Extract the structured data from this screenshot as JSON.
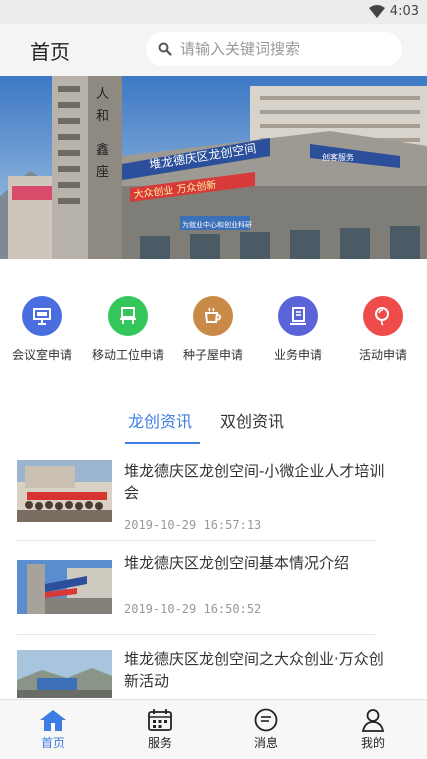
{
  "status_bar": {
    "time": "4:03",
    "wifi_icon": "wifi-icon"
  },
  "header": {
    "title": "首页",
    "search_placeholder": "请输入关键词搜索"
  },
  "banner": {
    "signs": [
      "人",
      "和",
      "鑫",
      "座"
    ],
    "building_sign": "堆龙德庆区龙创空间",
    "slogan": "大众创业 万众创新",
    "small_sign": "为就业中心和创业科研",
    "side_sign": "创客服务"
  },
  "quick_actions": [
    {
      "label": "会议室申请",
      "icon": "presentation-board-icon",
      "color": "#4a6ee0"
    },
    {
      "label": "移动工位申请",
      "icon": "workstation-icon",
      "color": "#34c65a"
    },
    {
      "label": "种子屋申请",
      "icon": "coffee-cup-icon",
      "color": "#c98a47"
    },
    {
      "label": "业务申请",
      "icon": "business-doc-icon",
      "color": "#5b63d8"
    },
    {
      "label": "活动申请",
      "icon": "balloon-icon",
      "color": "#ef4b4b"
    }
  ],
  "tabs": [
    {
      "label": "龙创资讯",
      "active": true
    },
    {
      "label": "双创资讯",
      "active": false
    }
  ],
  "news": [
    {
      "title": "堆龙德庆区龙创空间-小微企业人才培训会",
      "date": "2019-10-29 16:57:13"
    },
    {
      "title": "堆龙德庆区龙创空间基本情况介绍",
      "date": "2019-10-29 16:50:52"
    },
    {
      "title": "堆龙德庆区龙创空间之大众创业·万众创新活动",
      "date": ""
    }
  ],
  "tab_bar": [
    {
      "label": "首页",
      "icon": "home-icon",
      "active": true
    },
    {
      "label": "服务",
      "icon": "calendar-service-icon",
      "active": false
    },
    {
      "label": "消息",
      "icon": "message-icon",
      "active": false
    },
    {
      "label": "我的",
      "icon": "profile-icon",
      "active": false
    }
  ],
  "colors": {
    "accent": "#3d7de4",
    "header_bg": "#f4f4f4",
    "statusbar_bg": "#ececec"
  }
}
